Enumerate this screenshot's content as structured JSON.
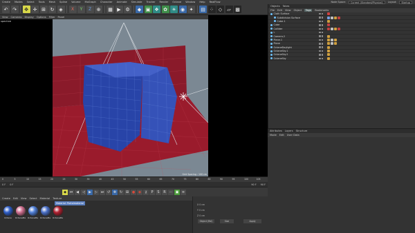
{
  "menubar": {
    "items": [
      "Create",
      "Modes",
      "Select",
      "Tools",
      "Mesh",
      "Spline",
      "Volume",
      "MoGraph",
      "Character",
      "Animate",
      "Simulate",
      "Tracker",
      "Render",
      "Octane",
      "Window",
      "Help",
      "RealFlow"
    ],
    "node_space_label": "Node Space:",
    "node_space_value": "Current (Standard/Physical)",
    "layout_label": "Layout:",
    "layout_value": "Startup"
  },
  "viewport": {
    "menu": [
      "View",
      "Cameras",
      "Display",
      "Options",
      "Filter",
      "Panel"
    ],
    "view_name": "spective",
    "grid_spacing": "Grid Spacing : 100 cm"
  },
  "objects_panel": {
    "tabs": [
      "Objects",
      "Takes"
    ],
    "menu": [
      "File",
      "Edit",
      "View",
      "Object",
      "Tags",
      "Bookmarks"
    ],
    "active_menu": "Tags",
    "rows": [
      {
        "name": "Cloth Surface",
        "color": "#6fc3ff",
        "tags": [
          "#d04040"
        ]
      },
      {
        "name": "Subdivision Surface",
        "color": "#6fc3ff",
        "tags": [
          "#7aa0e0",
          "#c0c0c0",
          "#d0a040",
          "#c04040"
        ]
      },
      {
        "name": "Cube.1",
        "color": "#6fc3ff",
        "tags": [
          "#d0a040"
        ]
      },
      {
        "name": "Cube",
        "color": "#6fc3ff",
        "tags": [
          "#c04040"
        ]
      },
      {
        "name": "Collider",
        "color": "#6fc3ff",
        "tags": [
          "#c04040",
          "#c0c0c0",
          "#d0a040",
          "#c04040"
        ]
      },
      {
        "name": "L",
        "color": "#6fc3ff",
        "tags": []
      },
      {
        "name": "Camera.2",
        "color": "#6fc3ff",
        "tags": [
          "#d0a040"
        ]
      },
      {
        "name": "Plane.1",
        "color": "#6fc3ff",
        "tags": [
          "#d0a040",
          "#c0c0c0",
          "#d0a040"
        ]
      },
      {
        "name": "Plane",
        "color": "#6fc3ff",
        "tags": [
          "#d0a040",
          "#c0c0c0",
          "#d0a040"
        ]
      },
      {
        "name": "OctaneDaylight",
        "color": "#6fc3ff",
        "tags": [
          "#d0a040"
        ]
      },
      {
        "name": "OctaneSky.1",
        "color": "#6fc3ff",
        "tags": [
          "#d0a040"
        ]
      },
      {
        "name": "OctaneSky.2",
        "color": "#6fc3ff",
        "tags": [
          "#d0a040"
        ]
      },
      {
        "name": "OctaneSky",
        "color": "#6fc3ff",
        "tags": [
          "#d0a040"
        ]
      }
    ]
  },
  "attributes_panel": {
    "tabs": [
      "Attributes",
      "Layers",
      "Structure"
    ],
    "menu": [
      "Mode",
      "Edit",
      "User Data"
    ]
  },
  "timeline": {
    "ticks": [
      "0",
      "5",
      "10",
      "15",
      "20",
      "25",
      "30",
      "35",
      "40",
      "45",
      "50",
      "55",
      "60",
      "65",
      "70",
      "75",
      "80",
      "85",
      "90",
      "95",
      "100",
      "105"
    ],
    "current_frame": "0 F",
    "start_frame": "0 F",
    "end_frame": "90 F",
    "max_frame": "90 F"
  },
  "material_manager": {
    "menu": [
      "Create",
      "Edit",
      "View",
      "Select",
      "Material",
      "Texture"
    ],
    "tooltip": "Material: Portalmaterial",
    "materials": [
      {
        "label": "Octane",
        "color": "#2e5ec8"
      },
      {
        "label": "OctaneMa",
        "color": "#d07090"
      },
      {
        "label": "OctaneMa",
        "color": "#5080d8"
      },
      {
        "label": "OctaneMa",
        "color": "#4a70c8"
      },
      {
        "label": "OctaneMa",
        "color": "#b02030"
      }
    ]
  },
  "coordinates": {
    "rows": [
      "X 0 cm",
      "Y 0 cm",
      "Z 0 cm"
    ],
    "buttons": [
      "Object (Rel)",
      "Size",
      "Apply"
    ]
  },
  "colors": {
    "accent_yellow": "#d8d84a",
    "accent_blue": "#3a69a8",
    "viewport_bg": "#7b8893"
  }
}
